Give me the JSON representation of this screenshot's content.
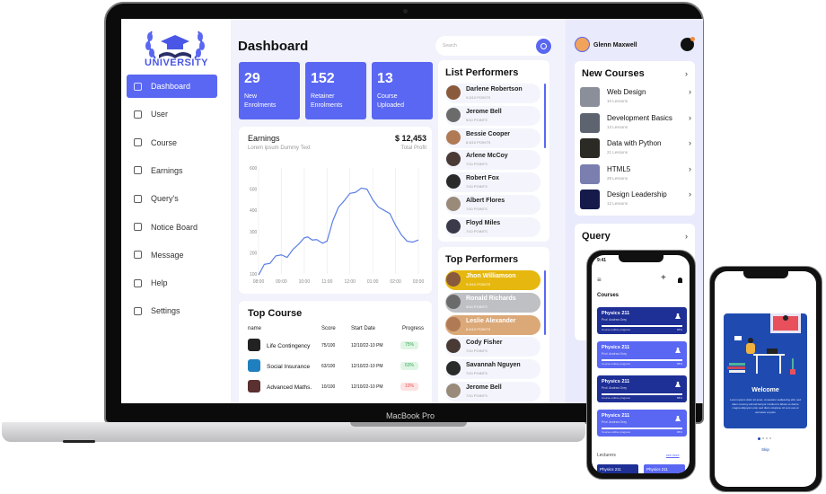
{
  "device_label": "MacBook Pro",
  "sidebar": {
    "logo_text": "UNIVERSITY",
    "items": [
      {
        "label": "Dashboard",
        "icon": "grid-icon",
        "active": true
      },
      {
        "label": "User",
        "icon": "user-icon"
      },
      {
        "label": "Course",
        "icon": "course-icon"
      },
      {
        "label": "Earnings",
        "icon": "earnings-icon"
      },
      {
        "label": "Query's",
        "icon": "query-icon"
      },
      {
        "label": "Notice Board",
        "icon": "notice-icon"
      },
      {
        "label": "Message",
        "icon": "message-icon"
      },
      {
        "label": "Help",
        "icon": "help-icon"
      },
      {
        "label": "Settings",
        "icon": "settings-icon"
      }
    ]
  },
  "header": {
    "title": "Dashboard",
    "search_placeholder": "Search"
  },
  "stats": [
    {
      "value": "29",
      "label1": "New",
      "label2": "Enrolments"
    },
    {
      "value": "152",
      "label1": "Retainer",
      "label2": "Enrolments"
    },
    {
      "value": "13",
      "label1": "Course",
      "label2": "Uploaded"
    }
  ],
  "earnings": {
    "title": "Earnings",
    "subtitle": "Lorem ipsum Dummy Text",
    "total": "$ 12,453",
    "total_label": "Total Profit"
  },
  "chart_data": {
    "type": "line",
    "title": "Earnings",
    "x": [
      "08:00",
      "09:00",
      "10:00",
      "11:00",
      "12:00",
      "01:00",
      "02:00",
      "03:00"
    ],
    "y_ticks": [
      100,
      200,
      300,
      400,
      500,
      600
    ],
    "ylim": [
      100,
      600
    ],
    "points": [
      [
        0,
        95
      ],
      [
        0.25,
        145
      ],
      [
        0.5,
        150
      ],
      [
        0.75,
        185
      ],
      [
        1,
        190
      ],
      [
        1.25,
        178
      ],
      [
        1.5,
        215
      ],
      [
        1.75,
        240
      ],
      [
        2,
        270
      ],
      [
        2.15,
        275
      ],
      [
        2.35,
        260
      ],
      [
        2.55,
        262
      ],
      [
        2.8,
        245
      ],
      [
        3,
        255
      ],
      [
        3.25,
        350
      ],
      [
        3.5,
        415
      ],
      [
        3.75,
        445
      ],
      [
        4,
        480
      ],
      [
        4.25,
        485
      ],
      [
        4.5,
        505
      ],
      [
        4.75,
        500
      ],
      [
        5,
        450
      ],
      [
        5.25,
        415
      ],
      [
        5.5,
        400
      ],
      [
        5.75,
        385
      ],
      [
        6,
        330
      ],
      [
        6.25,
        285
      ],
      [
        6.5,
        255
      ],
      [
        6.75,
        250
      ],
      [
        7,
        260
      ]
    ],
    "series_color": "#5a7ee6",
    "grid": true
  },
  "top_course": {
    "title": "Top Course",
    "headers": [
      "name",
      "Score",
      "Start Date",
      "Progress"
    ],
    "rows": [
      {
        "name": "Life Contingency",
        "score": "75/100",
        "date": "12/10/22-10 PM",
        "progress": "75%",
        "status": "good"
      },
      {
        "name": "Social Insurance",
        "score": "63/100",
        "date": "12/10/22-10 PM",
        "progress": "63%",
        "status": "good"
      },
      {
        "name": "Advanced Maths.",
        "score": "10/100",
        "date": "12/10/22-10 PM",
        "progress": "10%",
        "status": "bad"
      }
    ]
  },
  "list_performers": {
    "title": "List Performers",
    "items": [
      {
        "name": "Darlene Robertson",
        "points": "9.5/10 POINTS"
      },
      {
        "name": "Jerome Bell",
        "points": "9/10 POINTS"
      },
      {
        "name": "Bessie Cooper",
        "points": "8.5/10 POINTS"
      },
      {
        "name": "Arlene McCoy",
        "points": "7/10 POINTS"
      },
      {
        "name": "Robert Fox",
        "points": "7/10 POINTS"
      },
      {
        "name": "Albert Flores",
        "points": "7/10 POINTS"
      },
      {
        "name": "Floyd Miles",
        "points": "7/10 POINTS"
      }
    ]
  },
  "top_performers": {
    "title": "Top Performers",
    "items": [
      {
        "name": "Jhon Williamson",
        "points": "9.9/10 POINTS",
        "color": "#e6b80f"
      },
      {
        "name": "Ronald Richards",
        "points": "9/10 POINTS",
        "color": "#bfc0c4"
      },
      {
        "name": "Leslie Alexander",
        "points": "8.5/10 POINTS",
        "color": "#dba877"
      },
      {
        "name": "Cody Fisher",
        "points": "7/10 POINTS",
        "color": "#f4f5fc"
      },
      {
        "name": "Savannah Nguyen",
        "points": "7/10 POINTS",
        "color": "#f4f5fc"
      },
      {
        "name": "Jerome Bell",
        "points": "7/10 POINTS",
        "color": "#f4f5fc"
      }
    ]
  },
  "user": {
    "name": "Glenn Maxwell"
  },
  "new_courses": {
    "title": "New Courses",
    "items": [
      {
        "name": "Web Design",
        "lessons": "10 Lessons",
        "color": "#8a8f9a"
      },
      {
        "name": "Development Basics",
        "lessons": "13 Lessons",
        "color": "#5d6470"
      },
      {
        "name": "Data with Python",
        "lessons": "21 Lessons",
        "color": "#2b2a25"
      },
      {
        "name": "HTML5",
        "lessons": "28 Lessons",
        "color": "#7a7fb0"
      },
      {
        "name": "Design Leadership",
        "lessons": "12 Lessons",
        "color": "#151a4a"
      }
    ]
  },
  "query": {
    "title": "Query"
  },
  "phone1": {
    "time": "9:41",
    "section": "Courses",
    "cards": [
      {
        "name": "Physics 211",
        "prof": "Prof. Andrea Grey",
        "progress_label": "Course outline progress",
        "progress": "88%",
        "color": "#1e2f96"
      },
      {
        "name": "Physics 211",
        "prof": "Prof. Andrea Grey",
        "progress_label": "Course outline progress",
        "progress": "88%",
        "color": "#5a67f2"
      },
      {
        "name": "Physics 211",
        "prof": "Prof. Andrea Grey",
        "progress_label": "Course outline progress",
        "progress": "88%",
        "color": "#1e2f96"
      },
      {
        "name": "Physics 211",
        "prof": "Prof. Andrea Grey",
        "progress_label": "Course outline progress",
        "progress": "88%",
        "color": "#5a67f2"
      }
    ],
    "lecturers_label": "Lecturers",
    "see_more": "see more",
    "lecturer_cards": [
      "Physics 211",
      "Physics 211"
    ]
  },
  "phone2": {
    "welcome_title": "Welcome",
    "welcome_text": "Lorem ipsum dolor sit amet, consetetur sadipscing elitr, sed diam nonumy eirmod tempor invidunt ut labore et dolore magna aliquyam erat, sed diam voluptua. At vero eos et accusam et justo",
    "skip": "Skip"
  }
}
